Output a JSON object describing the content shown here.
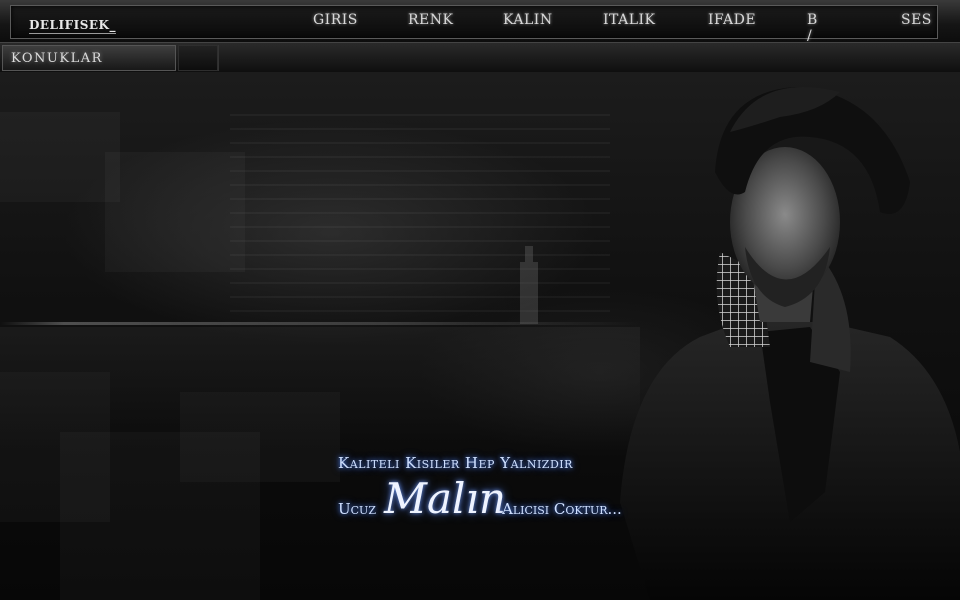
{
  "header": {
    "username": "DELIFISEK_",
    "menu": [
      {
        "label": "GIRIS"
      },
      {
        "label": "RENK"
      },
      {
        "label": "KALIN"
      },
      {
        "label": "ITALIK"
      },
      {
        "label": "IFADE"
      },
      {
        "label": "B / K"
      },
      {
        "label": "SES"
      }
    ]
  },
  "tabs": {
    "guests_label": "KONUKLAR"
  },
  "quote": {
    "line1": "Kaliteli Kisiler Hep Yalnizdir",
    "line2_start": "Ucuz",
    "line2_script": "Malın",
    "line2_end": "Alicisi Coktur..."
  },
  "colors": {
    "accent_glow": "#4f7bdc",
    "background": "#0b0b0b"
  }
}
